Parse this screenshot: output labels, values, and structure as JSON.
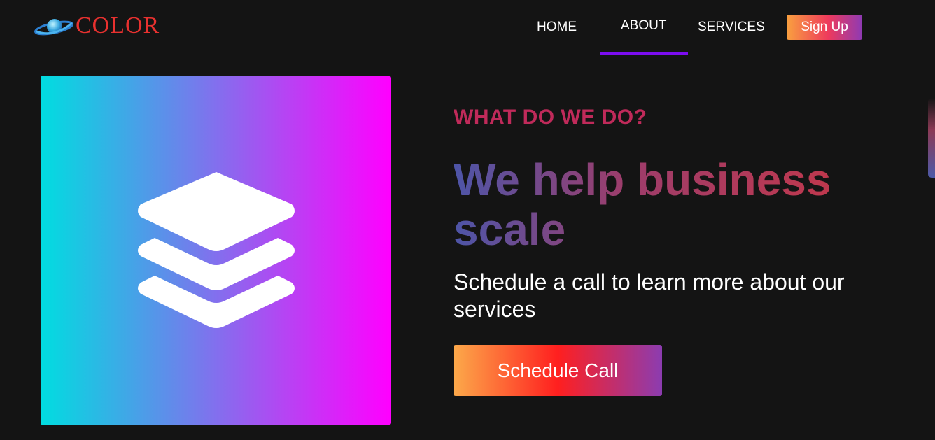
{
  "logo": {
    "text": "COLOR",
    "icon": "planet-icon"
  },
  "nav": {
    "items": [
      {
        "label": "HOME"
      },
      {
        "label": "ABOUT",
        "active": true
      },
      {
        "label": "SERVICES"
      }
    ],
    "signup_label": "Sign Up"
  },
  "hero": {
    "icon": "layers-icon",
    "eyebrow": "WHAT DO WE DO?",
    "headline": "We help business scale",
    "subheadline": "Schedule a call to learn more about our services",
    "cta_label": "Schedule Call"
  },
  "colors": {
    "background": "#141414",
    "logo_red": "#e8312f",
    "nav_active_underline": "#7c0df0",
    "eyebrow": "#c02a5a",
    "hero_gradient_start": "#00dde0",
    "hero_gradient_end": "#ff00ff"
  }
}
